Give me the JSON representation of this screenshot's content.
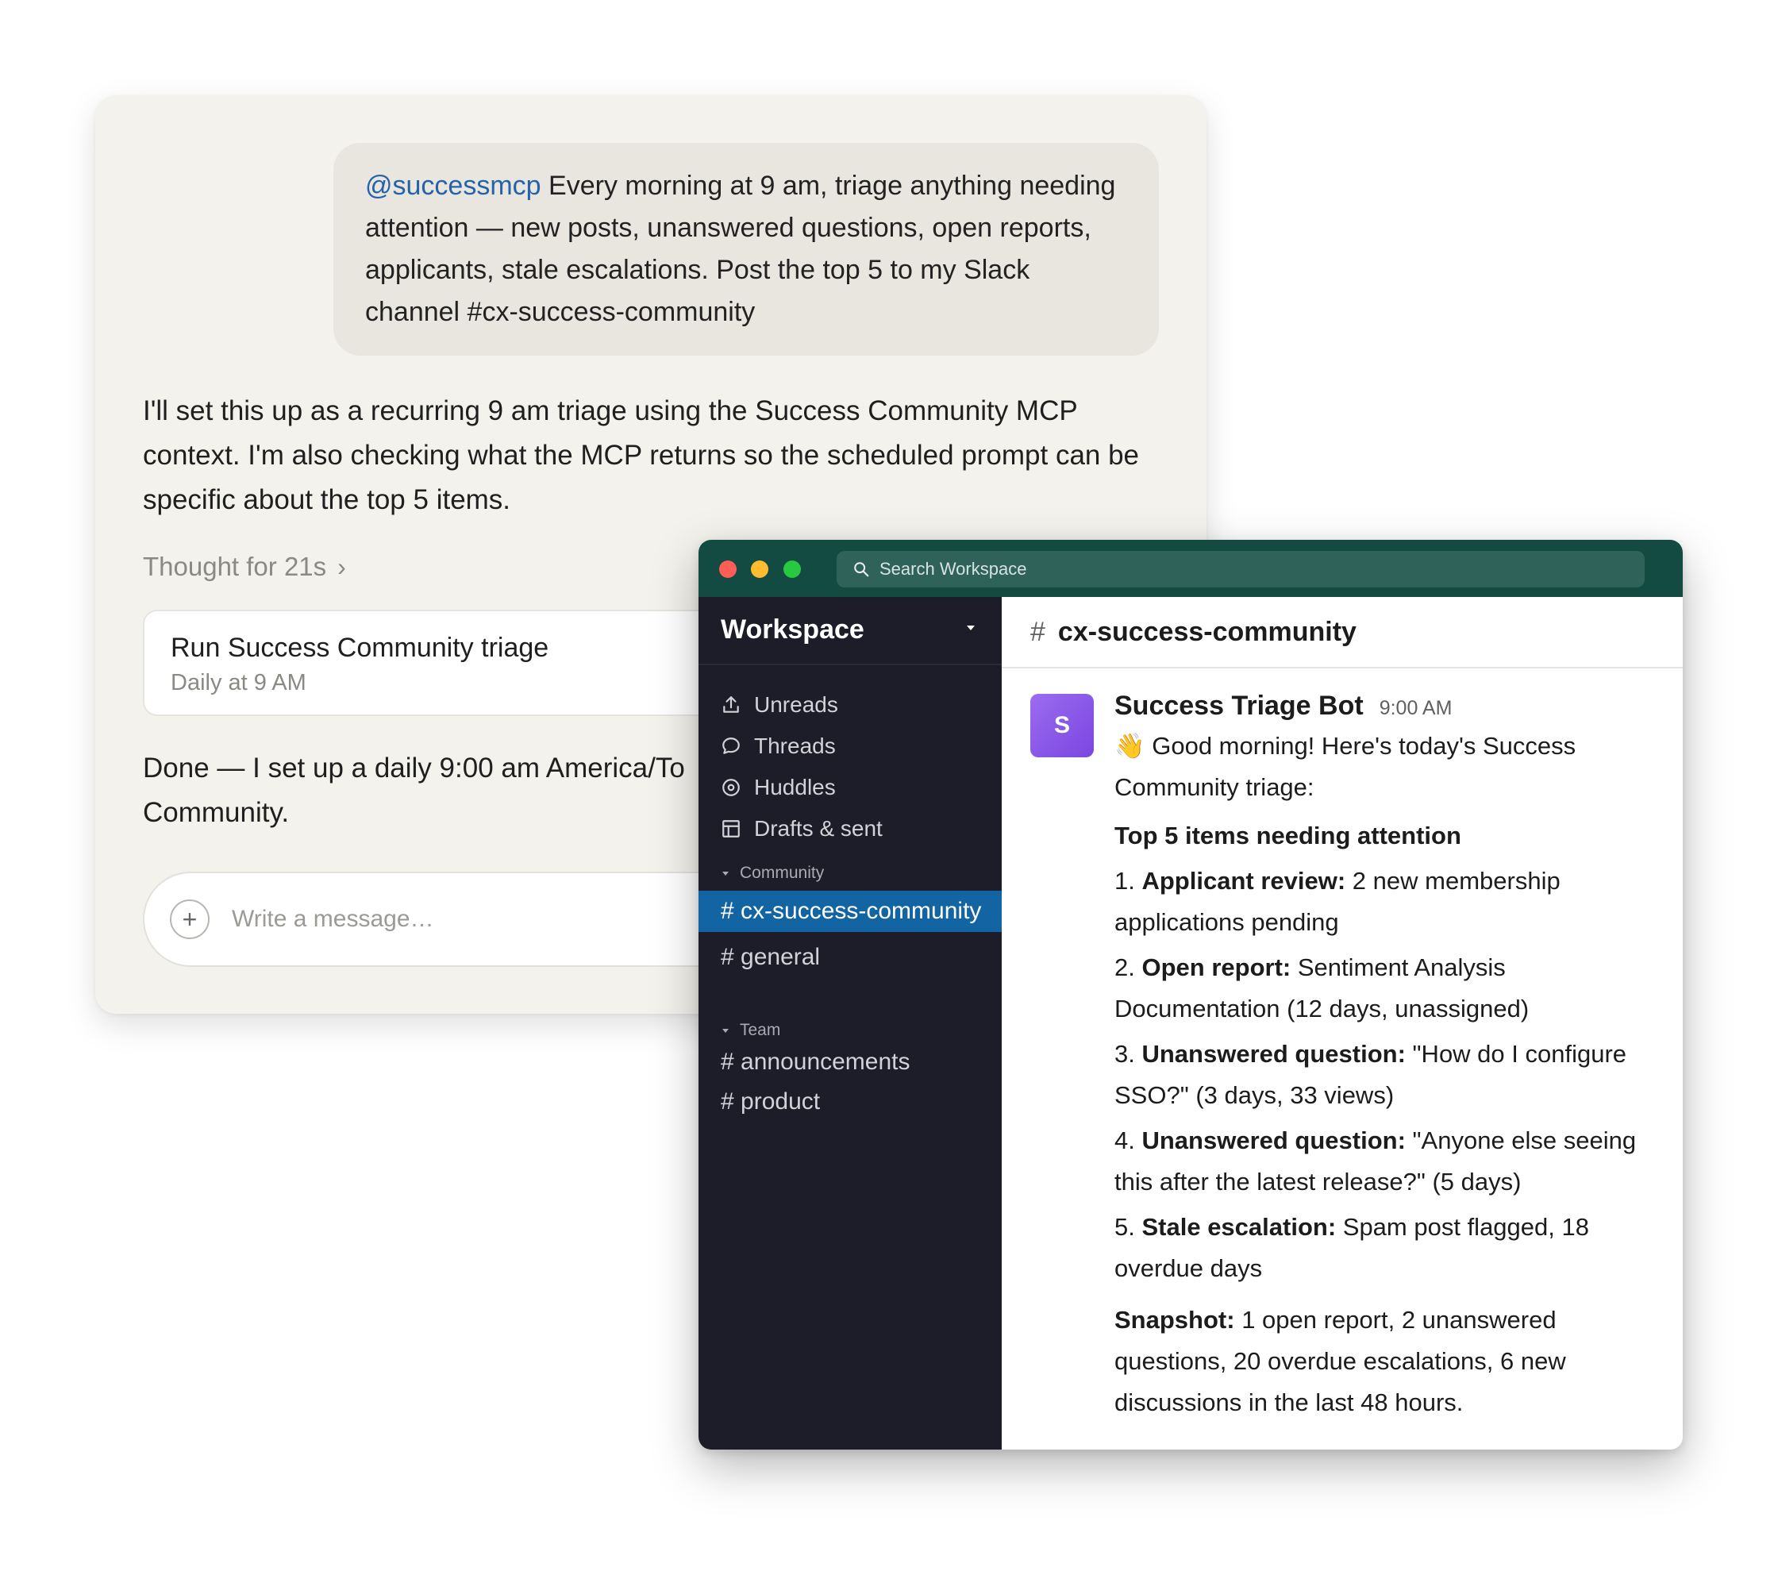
{
  "chat": {
    "user_message": {
      "mention": "@successmcp",
      "text": "Every morning at 9 am, triage anything needing attention — new posts, unanswered questions, open reports, applicants, stale escalations. Post the top 5 to my Slack channel #cx-success-community"
    },
    "assistant_intro": "I'll set this up as a recurring 9 am triage using the Success Community MCP context. I'm also checking what the MCP returns so the scheduled prompt can be specific about the top 5 items.",
    "thought_label": "Thought for 21s",
    "task_card": {
      "title": "Run Success Community triage",
      "schedule": "Daily at 9 AM"
    },
    "assistant_done": "Done — I set up a daily 9:00 am America/To",
    "assistant_done_cont": "Community.",
    "composer": {
      "placeholder": "Write a message…"
    }
  },
  "slack": {
    "search_placeholder": "Search Workspace",
    "workspace_name": "Workspace",
    "nav": [
      {
        "label": "Unreads",
        "icon": "unreads-icon"
      },
      {
        "label": "Threads",
        "icon": "threads-icon"
      },
      {
        "label": "Huddles",
        "icon": "huddles-icon"
      },
      {
        "label": "Drafts & sent",
        "icon": "drafts-icon"
      }
    ],
    "sections": [
      {
        "name": "Community",
        "channels": [
          "# cx-success-community",
          "# general"
        ]
      },
      {
        "name": "Team",
        "channels": [
          "# announcements",
          "# product"
        ]
      }
    ],
    "active_channel": "cx-success-community",
    "channel_header": {
      "hash": "#",
      "name": "cx-success-community"
    },
    "message": {
      "avatar_letter": "S",
      "author": "Success Triage Bot",
      "time": "9:00 AM",
      "greeting_emoji": "👋",
      "greeting": "Good morning! Here's today's Success Community triage:",
      "heading": "Top 5 items needing attention",
      "items": [
        {
          "num": "1.",
          "label": "Applicant review:",
          "text": "2 new membership applications pending"
        },
        {
          "num": "2.",
          "label": "Open report:",
          "text": "Sentiment Analysis Documentation (12 days, unassigned)"
        },
        {
          "num": "3.",
          "label": "Unanswered question:",
          "text": "\"How do I configure SSO?\" (3 days, 33 views)"
        },
        {
          "num": "4.",
          "label": "Unanswered question:",
          "text": "\"Anyone else seeing this after the latest release?\" (5 days)"
        },
        {
          "num": "5.",
          "label": "Stale escalation:",
          "text": "Spam post flagged, 18 overdue days"
        }
      ],
      "snapshot_label": "Snapshot:",
      "snapshot_text": "1 open report, 2 unanswered questions, 20 overdue escalations, 6 new discussions in the last 48 hours."
    },
    "colors": {
      "titlebar": "#134a42",
      "sidebar": "#1c1d29",
      "active_channel": "#1264a3",
      "avatar": "#8a5aea"
    }
  }
}
